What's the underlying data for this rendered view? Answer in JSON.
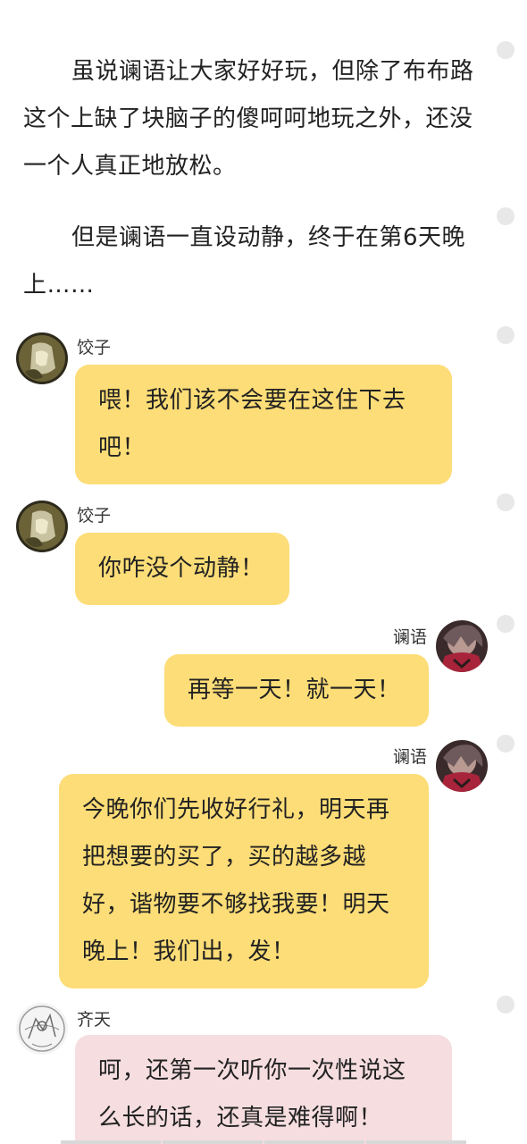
{
  "narration": [
    "虽说谰语让大家好好玩，但除了布布路这个上缺了块脑子的傻呵呵地玩之外，还没一个人真正地放松。",
    "但是谰语一直设动静，终于在第6天晚上……"
  ],
  "messages": [
    {
      "speaker": "饺子",
      "side": "left",
      "text": "喂！我们该不会要在这住下去吧！",
      "avatar": "dumpling-avatar-icon"
    },
    {
      "speaker": "饺子",
      "side": "left",
      "text": "你咋没个动静！",
      "avatar": "dumpling-avatar-icon"
    },
    {
      "speaker": "谰语",
      "side": "right",
      "text": "再等一天！就一天！",
      "avatar": "lanyu-avatar-icon"
    },
    {
      "speaker": "谰语",
      "side": "right",
      "text": "今晚你们先收好行礼，明天再把想要的买了，买的越多越好，谐物要不够找我要！明天晚上！我们出，发！",
      "avatar": "lanyu-avatar-icon"
    },
    {
      "speaker": "齐天",
      "side": "left",
      "text": "呵，还第一次听你一次性说这么长的话，还真是难得啊！",
      "avatar": "qitian-avatar-icon"
    }
  ],
  "colors": {
    "bubble_yellow": "#fddd77",
    "bubble_pink": "#f5dde0",
    "dot": "#e8e8e8"
  }
}
